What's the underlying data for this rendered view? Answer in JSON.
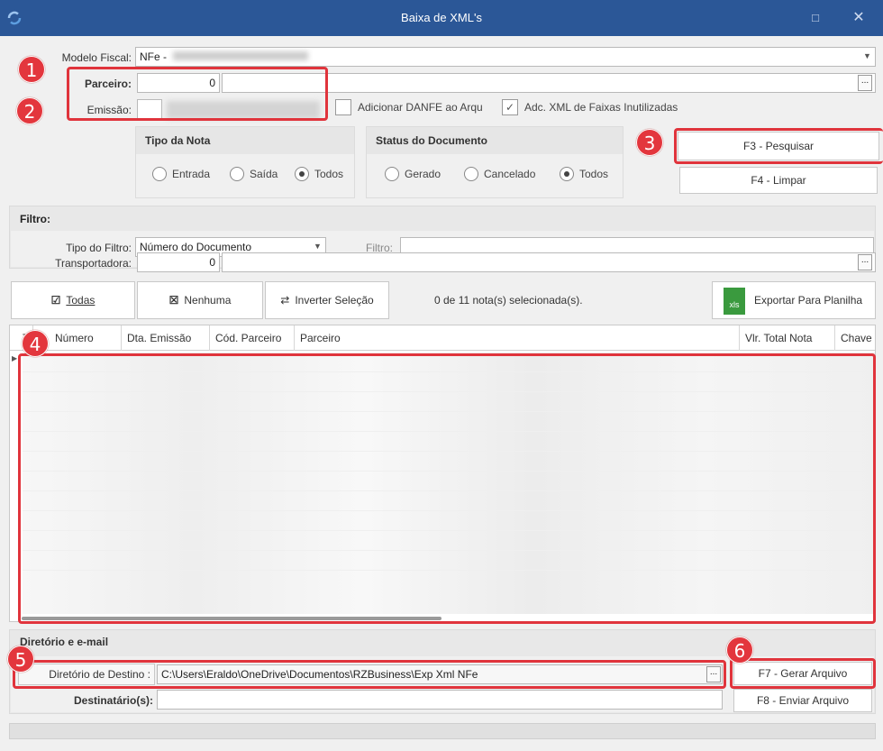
{
  "window": {
    "title": "Baixa de XML's",
    "min_glyph": "□",
    "close_glyph": "✕"
  },
  "header": {
    "modelo_fiscal_label": "Modelo Fiscal:",
    "modelo_fiscal_value": "NFe -",
    "parceiro_label": "Parceiro:",
    "parceiro_code": "0",
    "parceiro_name": "",
    "emissao_label": "Emissão:",
    "ellipsis": "...",
    "adicionar_danfe": "Adicionar DANFE ao Arqu",
    "adc_xml_faixas": "Adc. XML de Faixas Inutilizadas",
    "adc_xml_faixas_checked": true
  },
  "tipo_nota": {
    "title": "Tipo da Nota",
    "options": [
      "Entrada",
      "Saída",
      "Todos"
    ],
    "selected": "Todos"
  },
  "status_documento": {
    "title": "Status do Documento",
    "options": [
      "Gerado",
      "Cancelado",
      "Todos"
    ],
    "selected": "Todos"
  },
  "buttons": {
    "pesquisar": "F3 - Pesquisar",
    "limpar": "F4 - Limpar",
    "todas": "Todas",
    "nenhuma": "Nenhuma",
    "inverter": "Inverter Seleção",
    "exportar": "Exportar Para Planilha",
    "xls_label": "xls",
    "gerar_arquivo": "F7 - Gerar Arquivo",
    "enviar_arquivo": "F8 - Enviar Arquivo"
  },
  "filtro": {
    "section_label": "Filtro:",
    "tipo_label": "Tipo do Filtro:",
    "tipo_value": "Número do Documento",
    "filtro_label": "Filtro:",
    "filtro_value": ""
  },
  "transportadora": {
    "label": "Transportadora:",
    "code": "0",
    "name": ""
  },
  "selection_status": "0 de 11 nota(s) selecionada(s).",
  "grid": {
    "columns": [
      "T",
      "Número",
      "Dta. Emissão",
      "Cód. Parceiro",
      "Parceiro",
      "Vlr. Total Nota",
      "Chave"
    ]
  },
  "diretorio": {
    "section_label": "Diretório e e-mail",
    "destino_label": "Diretório de Destino :",
    "destino_value": "C:\\Users\\Eraldo\\OneDrive\\Documentos\\RZBusiness\\Exp Xml NFe",
    "destinatario_label": "Destinatário(s):",
    "destinatario_value": ""
  },
  "badges": [
    "1",
    "2",
    "3",
    "4",
    "5",
    "6"
  ],
  "colors": {
    "titlebar": "#2b5797",
    "annotation_red": "#e0343c",
    "xls_green": "#3a9a3e"
  }
}
